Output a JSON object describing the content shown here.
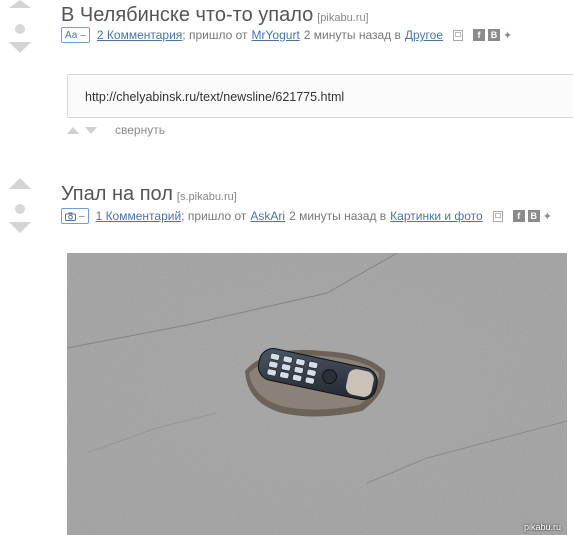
{
  "posts": [
    {
      "title": "В Челябинске что-то упало",
      "source": "[pikabu.ru]",
      "badge": "Аа",
      "badge_sep": "–",
      "comments": "2 Комментария",
      "from_prefix": "; пришло от",
      "author": "MrYogurt",
      "time_prefix": "2 минуты назад в",
      "category": "Другое",
      "link_url": "http://chelyabinsk.ru/text/newsline/621775.html",
      "collapse_label": "свернуть"
    },
    {
      "title": "Упал на пол",
      "source": "[s.pikabu.ru]",
      "badge_icon": "camera-icon",
      "badge_sep": "–",
      "comments": "1 Комментарий",
      "from_prefix": "; пришло от",
      "author": "AskAri",
      "time_prefix": "2 минуты назад в",
      "category": "Картинки и фото"
    }
  ],
  "social": {
    "facebook": "f",
    "vk": "B"
  },
  "watermark": "pikabu.ru",
  "colors": {
    "link": "#4a74a8",
    "badge_border": "#6fa0d6",
    "vote_gray": "#d4d4d4"
  }
}
